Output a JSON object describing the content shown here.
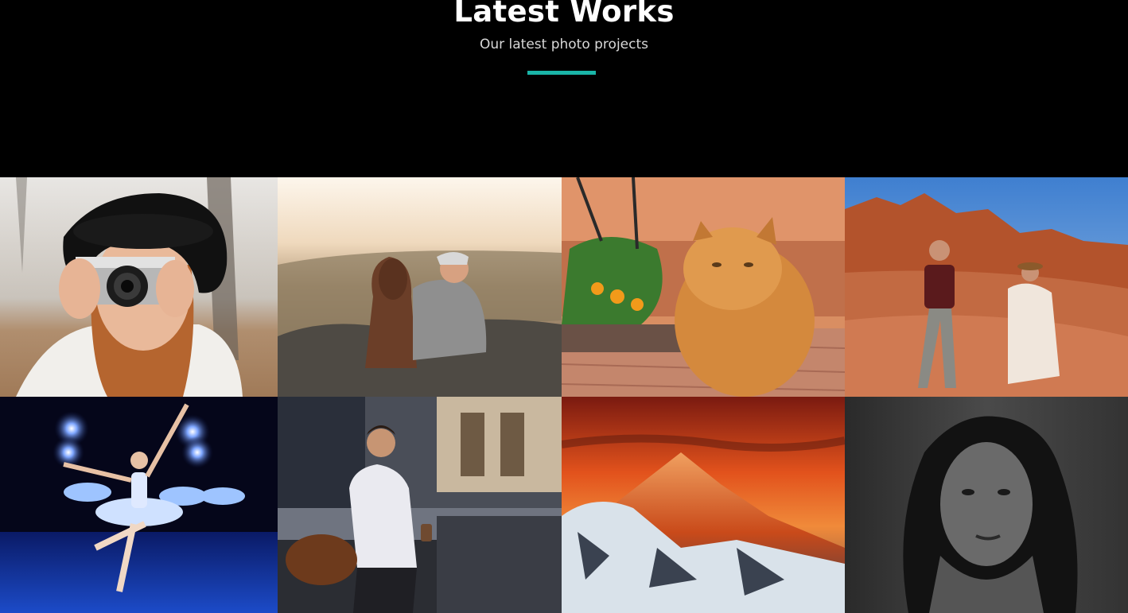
{
  "section": {
    "title": "Latest Works",
    "subtitle": "Our latest photo projects",
    "accent_color": "#1ab5a8",
    "background_color": "#000000"
  },
  "gallery": {
    "items": [
      {
        "subject": "woman-with-camera-photo"
      },
      {
        "subject": "couple-at-sunset-photo"
      },
      {
        "subject": "orange-persian-cat-photo"
      },
      {
        "subject": "desert-photographers-photo"
      },
      {
        "subject": "ballet-dancers-stage-photo"
      },
      {
        "subject": "man-with-leather-bag-photo"
      },
      {
        "subject": "mountain-peak-sunset-photo"
      },
      {
        "subject": "woman-with-braids-portrait-photo"
      }
    ]
  }
}
